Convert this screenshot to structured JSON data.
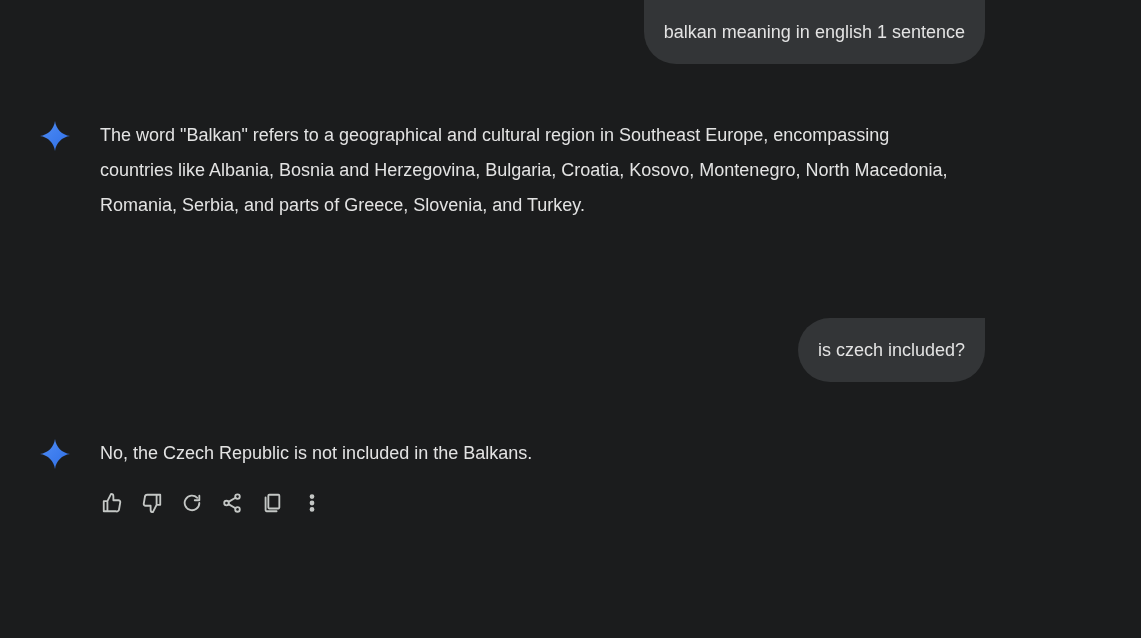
{
  "messages": [
    {
      "kind": "user",
      "text": "balkan meaning in english 1 sentence"
    },
    {
      "kind": "model",
      "text": "The word \"Balkan\" refers to a geographical and cultural region in Southeast Europe, encompassing countries like Albania, Bosnia and Herzegovina, Bulgaria, Croatia, Kosovo, Montenegro, North Macedonia, Romania, Serbia, and parts of Greece, Slovenia, and Turkey."
    },
    {
      "kind": "user",
      "text": "is czech included?"
    },
    {
      "kind": "model",
      "text": "No, the Czech Republic is not included in the Balkans.",
      "actions": [
        {
          "kind": "like"
        },
        {
          "kind": "dislike"
        },
        {
          "kind": "regenerate"
        },
        {
          "kind": "share"
        },
        {
          "kind": "copy"
        },
        {
          "kind": "more"
        }
      ]
    }
  ]
}
